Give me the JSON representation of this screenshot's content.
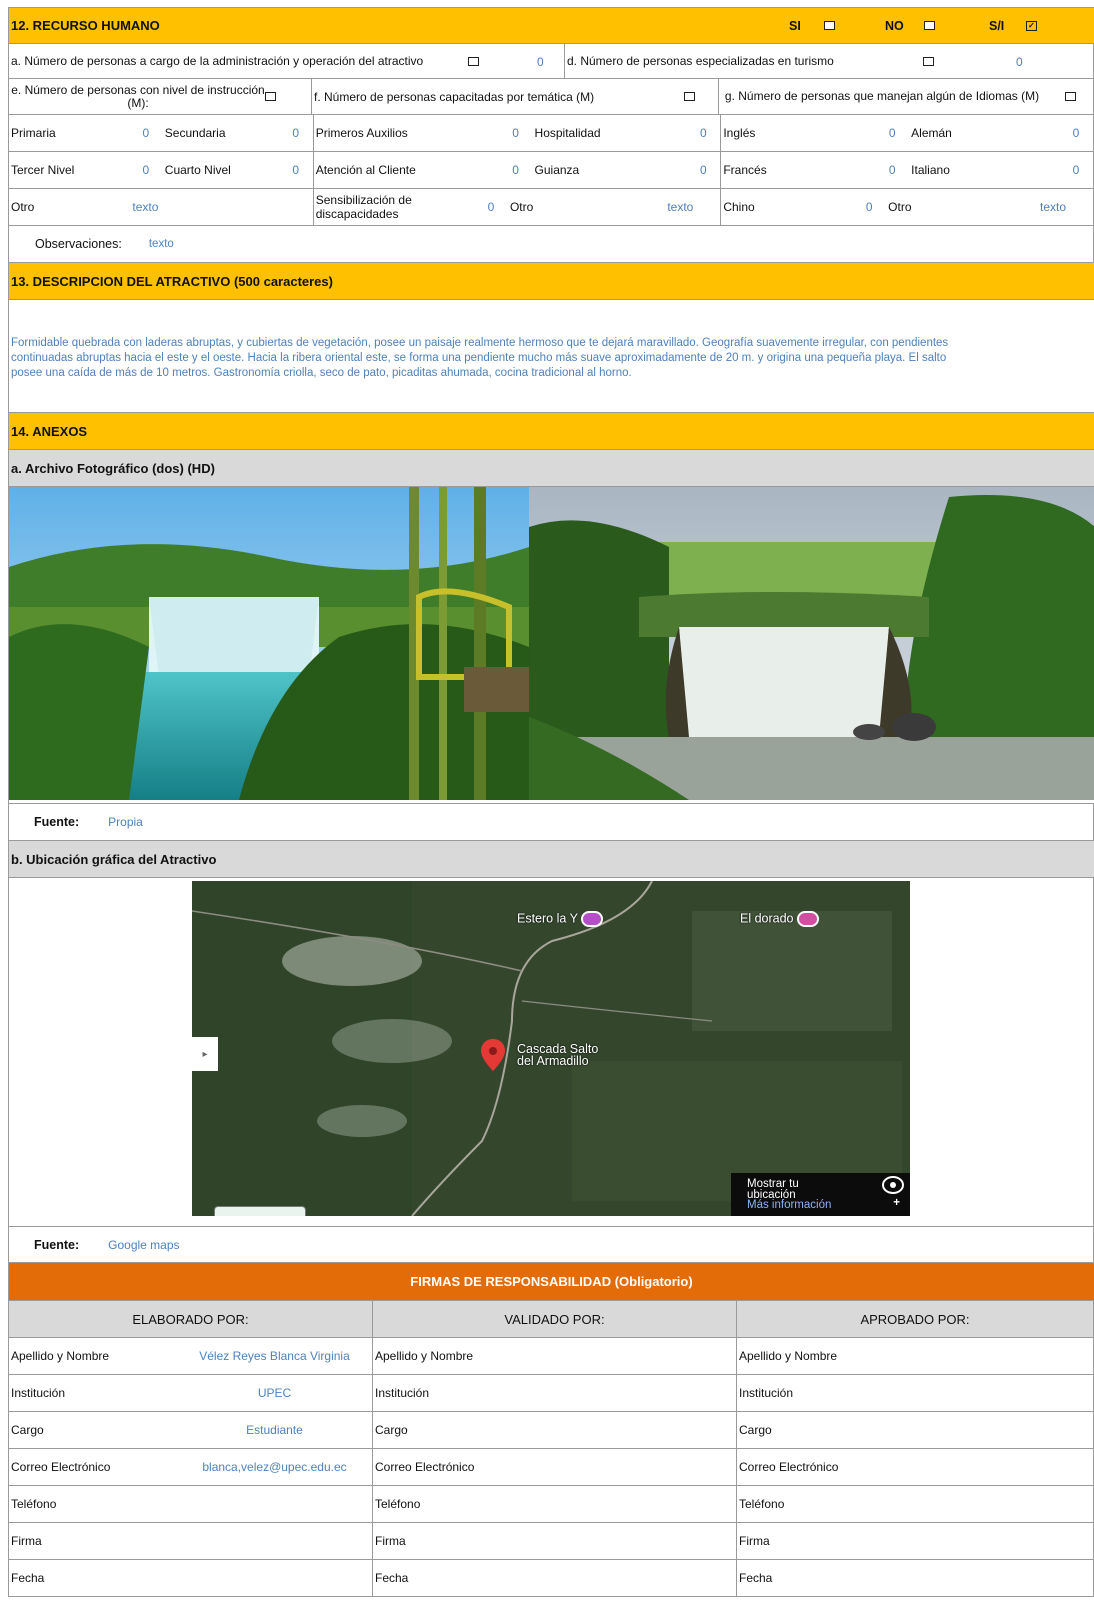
{
  "section12": {
    "title": "12. RECURSO HUMANO",
    "si": "SI",
    "no": "NO",
    "sn": "S/I",
    "a_label": "a. Número de personas a cargo de la administración y operación del atractivo",
    "a_value": "0",
    "d_label": "d. Número de personas especializadas en turismo",
    "d_value": "0",
    "e_label": "e. Número de personas con nivel de instrucción (M):",
    "f_label": "f. Número de personas capacitadas por temática (M)",
    "g_label": "g. Número de personas que manejan algún de Idiomas (M)",
    "rows": [
      [
        "Primaria",
        "0",
        "Secundaria",
        "0",
        "Primeros Auxilios",
        "0",
        "Hospitalidad",
        "0",
        "Inglés",
        "0",
        "Alemán",
        "0"
      ],
      [
        "Tercer Nivel",
        "0",
        "Cuarto Nivel",
        "0",
        "Atención al Cliente",
        "0",
        "Guianza",
        "0",
        "Francés",
        "0",
        "Italiano",
        "0"
      ],
      [
        "Otro",
        "texto",
        "",
        "",
        "Sensibilización de discapacidades",
        "0",
        "Otro",
        "texto",
        "Chino",
        "0",
        "Otro",
        "texto"
      ]
    ],
    "obs_label": "Observaciones:",
    "obs_value": "texto"
  },
  "section13": {
    "title": "13. DESCRIPCION DEL ATRACTIVO (500 caracteres)",
    "line1": "Formidable quebrada con laderas abruptas, y cubiertas de vegetación, posee un paisaje realmente hermoso que te dejará maravillado. Geografía suavemente irregular, con pendientes",
    "line2": "continuadas abruptas hacia el este y el oeste. Hacia la ribera oriental este, se forma una pendiente mucho más suave aproximadamente de 20 m. y origina una pequeña playa. El salto",
    "line3": "posee una caída de más de 10 metros. Gastronomía criolla, seco de pato, picaditas ahumada, cocina tradicional al horno."
  },
  "section14": {
    "title": "14. ANEXOS",
    "photo_title": "a. Archivo Fotográfico (dos) (HD)",
    "fuente_label": "Fuente:",
    "photo_source": "Propia",
    "map_title": "b. Ubicación gráfica del Atractivo",
    "map_source": "Google maps",
    "map": {
      "place1": "Estero la Y",
      "place2": "El dorado",
      "marker_line1": "Cascada Salto",
      "marker_line2": "del Armadillo",
      "panel_line1": "Mostrar tu",
      "panel_line2": "ubicación",
      "panel_link": "Más información",
      "expand_glyph": "▸",
      "zoom_plus": "+"
    }
  },
  "firmas": {
    "title": "FIRMAS DE RESPONSABILIDAD (Obligatorio)",
    "cols": [
      "ELABORADO POR:",
      "VALIDADO POR:",
      "APROBADO POR:"
    ],
    "labels": [
      "Apellido y Nombre",
      "Institución",
      "Cargo",
      "Correo Electrónico",
      "Teléfono",
      "Firma",
      "Fecha"
    ],
    "elaborado_values": [
      "Vélez Reyes Blanca Virginia",
      "UPEC",
      "Estudiante",
      "blanca,velez@upec.edu.ec",
      "",
      "",
      ""
    ]
  }
}
